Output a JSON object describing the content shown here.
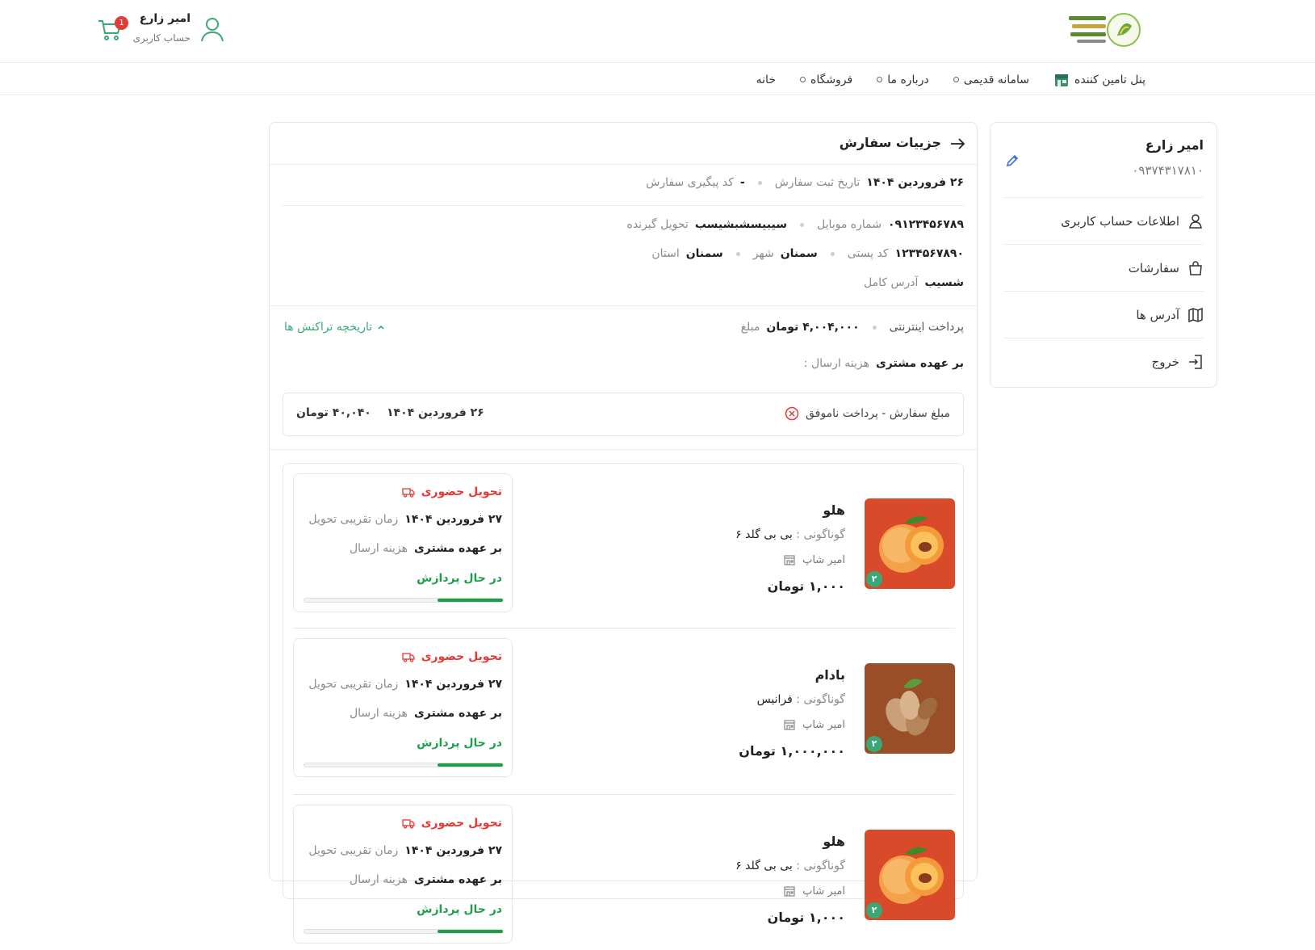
{
  "header": {
    "user_name": "امیر زارع",
    "user_subtitle": "حساب کاربری",
    "cart_count": "1"
  },
  "nav": {
    "items": [
      {
        "label": "خانه",
        "dot": false
      },
      {
        "label": "فروشگاه",
        "dot": true
      },
      {
        "label": "درباره ما",
        "dot": true
      },
      {
        "label": "سامانه قدیمی",
        "dot": true
      },
      {
        "label": "پنل تامین کننده",
        "dot": false
      }
    ]
  },
  "sidebar": {
    "name": "امیر زارع",
    "phone": "۰۹۳۷۴۳۱۷۸۱۰",
    "items": [
      {
        "label": "اطلاعات حساب کاربری",
        "icon": "user-icon"
      },
      {
        "label": "سفارشات",
        "icon": "bag-icon"
      },
      {
        "label": "آدرس ها",
        "icon": "map-icon"
      },
      {
        "label": "خروج",
        "icon": "logout-icon"
      }
    ]
  },
  "order": {
    "title": "جزییات سفارش",
    "tracking_label": "کد پیگیری سفارش",
    "tracking_value": "-",
    "date_label": "تاریخ ثبت سفارش",
    "date_value": "۲۶ فروردین ۱۴۰۴",
    "receiver_label": "تحویل گیرنده",
    "receiver_value": "سیبیسشبشیسب",
    "mobile_label": "شماره موبایل",
    "mobile_value": "۰۹۱۲۳۴۵۶۷۸۹",
    "province_label": "استان",
    "province_value": "سمنان",
    "city_label": "شهر",
    "city_value": "سمنان",
    "postal_label": "کد پستی",
    "postal_value": "۱۲۳۴۵۶۷۸۹۰",
    "address_label": "آدرس کامل",
    "address_value": "شسیب",
    "amount_label": "مبلغ",
    "amount_value": "۴,۰۰۴,۰۰۰ تومان",
    "payment_method": "پرداخت اینترنتی",
    "transactions_toggle": "تاریخچه تراکنش ها",
    "shipping_label": "هزینه ارسال :",
    "shipping_value": "بر عهده مشتری"
  },
  "transaction": {
    "status": "مبلغ سفارش - پرداخت ناموفق",
    "date": "۲۶ فروردین ۱۴۰۴",
    "amount": "۴۰,۰۴۰ تومان"
  },
  "items": [
    {
      "name": "هلو",
      "variant_label": "گوناگونی :",
      "variant_value": "بی بی گلد ۶",
      "shop": "امیر شاپ",
      "price": "۱,۰۰۰ تومان",
      "qty": "۲",
      "image": "peach",
      "delivery_type": "تحویل حضوری",
      "eta_label": "زمان تقریبی تحویل",
      "eta_value": "۲۷ فروردین ۱۴۰۴",
      "shipping_label": "هزینه ارسال",
      "shipping_value": "بر عهده مشتری",
      "status": "در حال پردازش",
      "progress": 0.33
    },
    {
      "name": "بادام",
      "variant_label": "گوناگونی :",
      "variant_value": "فرانیس",
      "shop": "امیر شاپ",
      "price": "۱,۰۰۰,۰۰۰ تومان",
      "qty": "۲",
      "image": "almond",
      "delivery_type": "تحویل حضوری",
      "eta_label": "زمان تقریبی تحویل",
      "eta_value": "۲۷ فروردین ۱۴۰۴",
      "shipping_label": "هزینه ارسال",
      "shipping_value": "بر عهده مشتری",
      "status": "در حال پردازش",
      "progress": 0.33
    },
    {
      "name": "هلو",
      "variant_label": "گوناگونی :",
      "variant_value": "بی بی گلد ۶",
      "shop": "امیر شاپ",
      "price": "۱,۰۰۰ تومان",
      "qty": "۲",
      "image": "peach",
      "delivery_type": "تحویل حضوری",
      "eta_label": "زمان تقریبی تحویل",
      "eta_value": "۲۷ فروردین ۱۴۰۴",
      "shipping_label": "هزینه ارسال",
      "shipping_value": "بر عهده مشتری",
      "status": "در حال پردازش",
      "progress": 0.33
    }
  ],
  "colors": {
    "accent": "#3aa876",
    "danger": "#e53935",
    "success": "#1e9e4a"
  }
}
